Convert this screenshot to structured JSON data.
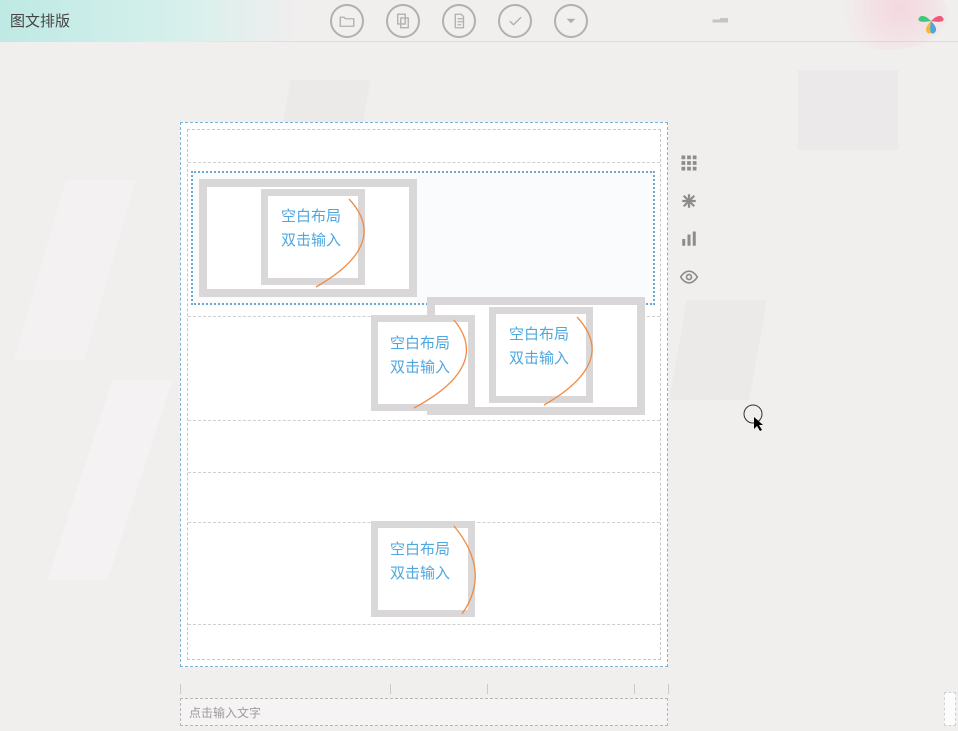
{
  "header": {
    "title": "图文排版",
    "smudge": "▂▃"
  },
  "toolbar": {
    "items": [
      {
        "name": "folder-icon"
      },
      {
        "name": "copy-icon"
      },
      {
        "name": "document-icon"
      },
      {
        "name": "check-icon"
      },
      {
        "name": "dropdown-icon"
      }
    ]
  },
  "side_tools": {
    "items": [
      {
        "name": "grid-icon"
      },
      {
        "name": "asterisk-icon"
      },
      {
        "name": "chart-icon"
      },
      {
        "name": "eye-icon"
      }
    ]
  },
  "cards": {
    "line1": "空白布局",
    "line2": "双击输入"
  },
  "bottom": {
    "placeholder": "点击输入文字"
  },
  "colors": {
    "dashed_blue": "#7cb3d6",
    "label_blue": "#4fa7e0",
    "curve_orange": "#f08b44",
    "frame_gray": "#d9d7d7"
  }
}
